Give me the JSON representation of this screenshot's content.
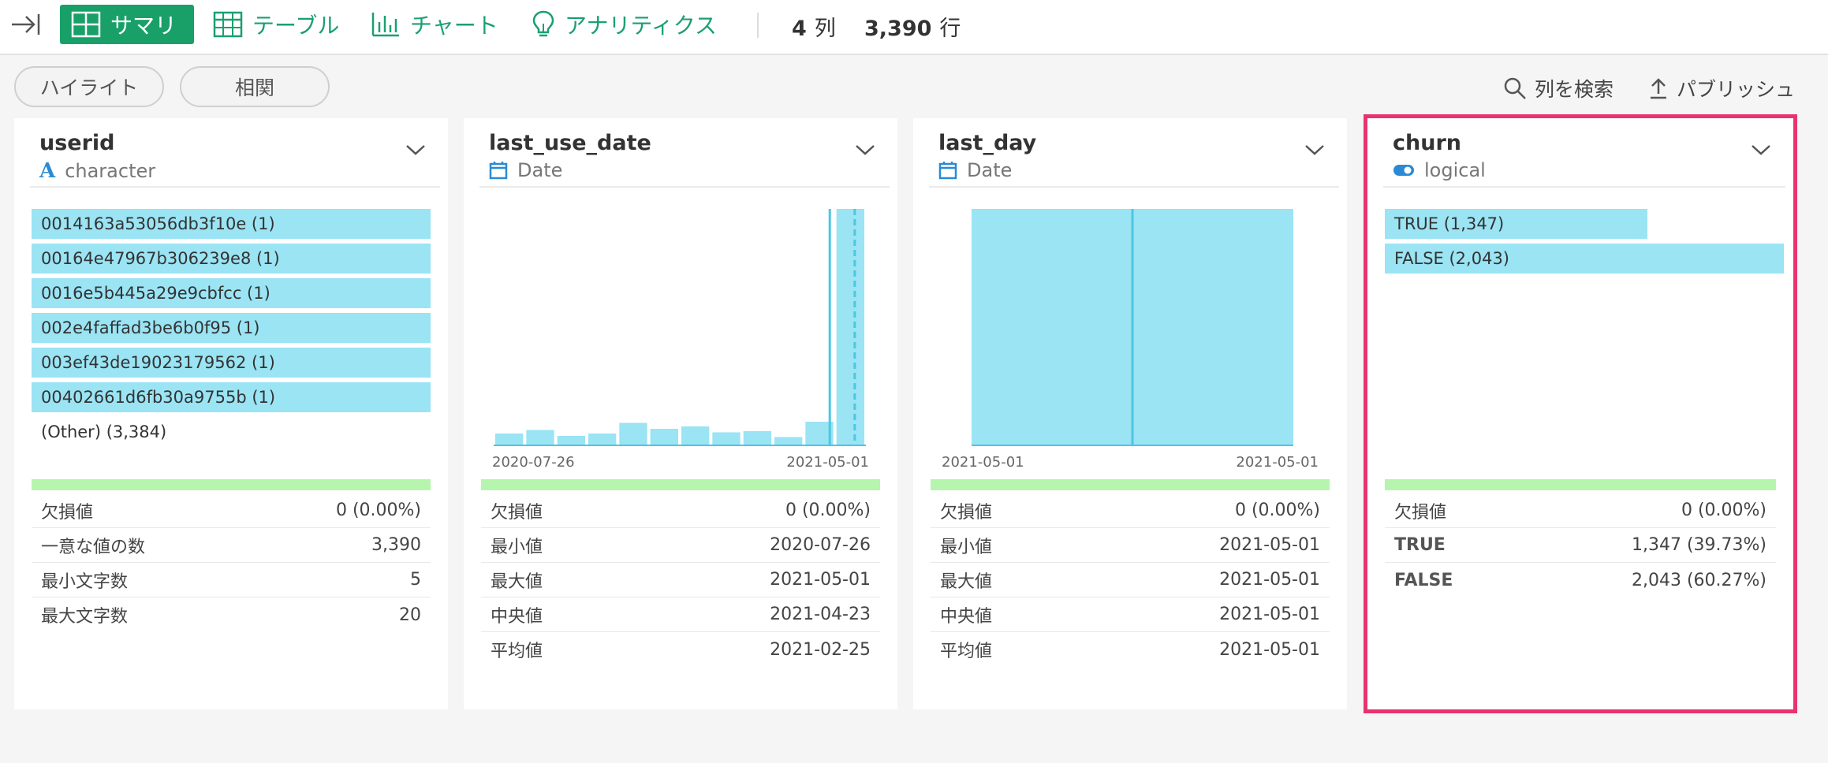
{
  "toolbar": {
    "tabs": [
      {
        "label": "サマリ",
        "icon": "grid-icon",
        "active": true
      },
      {
        "label": "テーブル",
        "icon": "table-icon",
        "active": false
      },
      {
        "label": "チャート",
        "icon": "bar-chart-icon",
        "active": false
      },
      {
        "label": "アナリティクス",
        "icon": "lightbulb-icon",
        "active": false
      }
    ],
    "columns_count": "4",
    "columns_unit": "列",
    "rows_count": "3,390",
    "rows_unit": "行"
  },
  "subtoolbar": {
    "highlight_label": "ハイライト",
    "correlation_label": "相関",
    "search_columns_label": "列を検索",
    "publish_label": "パブリッシュ"
  },
  "colors": {
    "accent_green": "#18a068",
    "bar_blue": "#9ae4f4",
    "line_blue": "#4cc7e2",
    "summary_green": "#b5f5ad",
    "selected_border": "#e8336f",
    "type_icon_blue": "#2a8ad4"
  },
  "cards": [
    {
      "name": "userid",
      "type": "character",
      "type_icon": "character-type-icon",
      "values": [
        {
          "label": "0014163a53056db3f10e (1)",
          "fraction": 1.0
        },
        {
          "label": "00164e47967b306239e8 (1)",
          "fraction": 1.0
        },
        {
          "label": "0016e5b445a29e9cbfcc (1)",
          "fraction": 1.0
        },
        {
          "label": "002e4faffad3be6b0f95 (1)",
          "fraction": 1.0
        },
        {
          "label": "003ef43de19023179562 (1)",
          "fraction": 1.0
        },
        {
          "label": "00402661d6fb30a9755b (1)",
          "fraction": 1.0
        }
      ],
      "other": "(Other) (3,384)",
      "stats": [
        {
          "label": "欠損値",
          "value": "0 (0.00%)"
        },
        {
          "label": "一意な値の数",
          "value": "3,390"
        },
        {
          "label": "最小文字数",
          "value": "5"
        },
        {
          "label": "最大文字数",
          "value": "20"
        }
      ]
    },
    {
      "name": "last_use_date",
      "type": "Date",
      "type_icon": "calendar-icon",
      "histogram": {
        "relative_heights": [
          0.05,
          0.065,
          0.04,
          0.05,
          0.095,
          0.07,
          0.08,
          0.055,
          0.06,
          0.035,
          0.1,
          1.0
        ],
        "median_fraction": 0.903,
        "mean_fraction": 0.97,
        "x_start": "2020-07-26",
        "x_end": "2021-05-01"
      },
      "stats": [
        {
          "label": "欠損値",
          "value": "0 (0.00%)"
        },
        {
          "label": "最小値",
          "value": "2020-07-26"
        },
        {
          "label": "最大値",
          "value": "2021-05-01"
        },
        {
          "label": "中央値",
          "value": "2021-04-23"
        },
        {
          "label": "平均値",
          "value": "2021-02-25"
        }
      ]
    },
    {
      "name": "last_day",
      "type": "Date",
      "type_icon": "calendar-icon",
      "histogram": {
        "relative_heights": [
          1.0
        ],
        "median_fraction": 0.5,
        "x_start": "2021-05-01",
        "x_end": "2021-05-01"
      },
      "stats": [
        {
          "label": "欠損値",
          "value": "0 (0.00%)"
        },
        {
          "label": "最小値",
          "value": "2021-05-01"
        },
        {
          "label": "最大値",
          "value": "2021-05-01"
        },
        {
          "label": "中央値",
          "value": "2021-05-01"
        },
        {
          "label": "平均値",
          "value": "2021-05-01"
        }
      ]
    },
    {
      "name": "churn",
      "type": "logical",
      "type_icon": "toggle-icon",
      "values": [
        {
          "label": "TRUE (1,347)",
          "fraction": 0.659
        },
        {
          "label": "FALSE (2,043)",
          "fraction": 1.0
        }
      ],
      "stats": [
        {
          "label": "欠損値",
          "value": "0 (0.00%)",
          "bold": false
        },
        {
          "label": "TRUE",
          "value": "1,347 (39.73%)",
          "bold": true
        },
        {
          "label": "FALSE",
          "value": "2,043 (60.27%)",
          "bold": true
        }
      ]
    }
  ]
}
